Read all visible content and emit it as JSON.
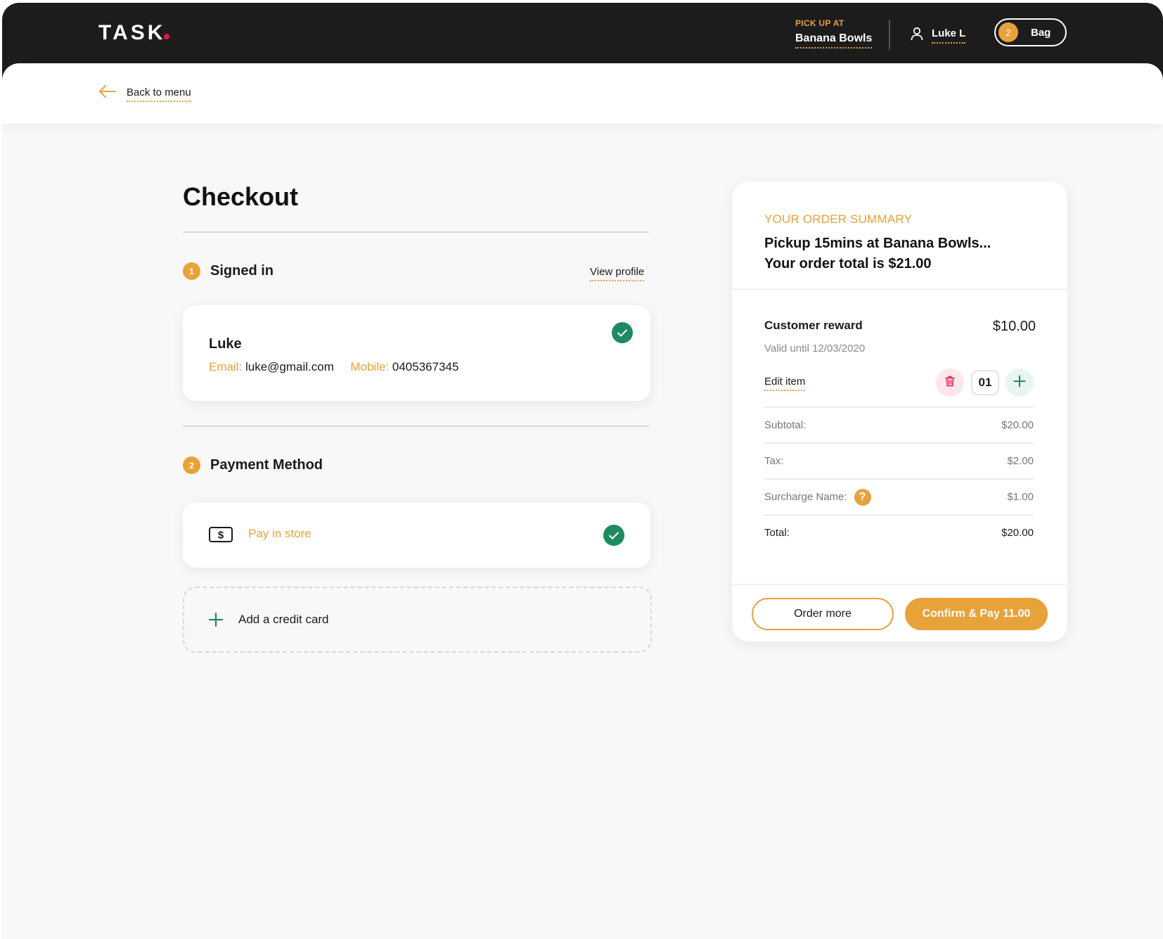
{
  "header": {
    "logo": "TASK",
    "pickup_label": "PICK UP AT",
    "pickup_store": "Banana Bowls",
    "user_name": "Luke L",
    "bag_count": "2",
    "bag_label": "Bag"
  },
  "nav": {
    "back_label": "Back to menu"
  },
  "checkout": {
    "title": "Checkout",
    "step1": {
      "number": "1",
      "title": "Signed in",
      "view_profile": "View profile"
    },
    "user": {
      "name": "Luke",
      "email_label": "Email:",
      "email": "luke@gmail.com",
      "mobile_label": "Mobile:",
      "mobile": "0405367345"
    },
    "step2": {
      "number": "2",
      "title": "Payment Method"
    },
    "payment": {
      "pay_in_store": "Pay in store",
      "add_credit_card": "Add a credit card"
    }
  },
  "summary": {
    "label": "YOUR ORDER SUMMARY",
    "title_line1": "Pickup 15mins at Banana Bowls...",
    "title_line2": "Your order total is $21.00",
    "item": {
      "name": "Customer reward",
      "price": "$10.00",
      "valid": "Valid until 12/03/2020",
      "edit": "Edit item",
      "quantity": "01"
    },
    "rows": [
      {
        "label": "Subtotal:",
        "value": "$20.00"
      },
      {
        "label": "Tax:",
        "value": "$2.00"
      },
      {
        "label": "Surcharge Name:",
        "value": "$1.00"
      },
      {
        "label": "Total:",
        "value": "$20.00"
      }
    ],
    "order_more": "Order more",
    "confirm_pay": "Confirm & Pay 11.00"
  },
  "colors": {
    "accent": "#e8a23a",
    "success": "#1c8b62",
    "header_bg": "#1c1c1c",
    "brand_dot": "#e0194b",
    "danger_soft": "#fde6ec"
  },
  "icons": [
    "user-icon",
    "arrow-left-icon",
    "check-icon",
    "dollar-bill-icon",
    "plus-icon",
    "trash-icon",
    "question-icon"
  ]
}
